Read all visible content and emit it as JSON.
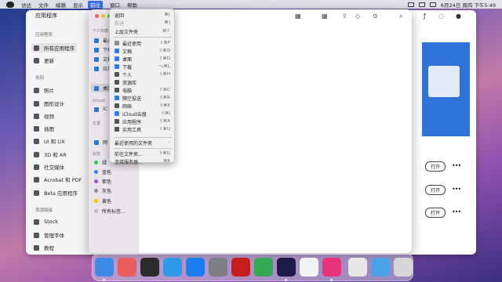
{
  "menubar": {
    "items": [
      "访达",
      "文件",
      "编辑",
      "显示",
      "前往",
      "窗口",
      "帮助"
    ],
    "active_index": 4,
    "clock": "6月24日 周四 下午5:49"
  },
  "cc": {
    "tab": "应用程序",
    "section_apps": "应用程序",
    "all_apps": "所有应用程序",
    "updates": "更新",
    "section_category": "类别",
    "categories": [
      "照片",
      "图形设计",
      "视频",
      "插图",
      "UI 和 UX",
      "3D 和 AR",
      "社交媒体",
      "Acrobat 和 PDF",
      "Beta 应用程序"
    ],
    "section_resources": "资源链接",
    "resources": [
      "Stock",
      "管理字体",
      "教程"
    ],
    "open_label": "打开",
    "more_label": "•••"
  },
  "finder": {
    "fav_header": "个人收藏",
    "fav_items": [
      "最近",
      "下载",
      "文稿",
      "应用",
      "桌面"
    ],
    "icloud_header": "iCloud",
    "icloud_items": [
      "iC"
    ],
    "loc_header": "位置",
    "loc_items": [
      "网"
    ],
    "tags_header": "标签",
    "tags": [
      {
        "label": "绿",
        "color": "#34c759"
      },
      {
        "label": "蓝色",
        "color": "#2f7cf6"
      },
      {
        "label": "紫色",
        "color": "#a050d8"
      },
      {
        "label": "灰色",
        "color": "#8e8e93"
      },
      {
        "label": "黄色",
        "color": "#f5c400"
      },
      {
        "label": "所有标签…",
        "color": "#bdbdbd"
      }
    ]
  },
  "go_menu": {
    "back": {
      "label": "返回",
      "shortcut": "⌘["
    },
    "forward": {
      "label": "前进",
      "shortcut": "⌘]"
    },
    "enclosing": {
      "label": "上层文件夹",
      "shortcut": "⌘↑"
    },
    "places": [
      {
        "label": "最近使用",
        "shortcut": "⇧⌘F",
        "color": "#8e8e93"
      },
      {
        "label": "文稿",
        "shortcut": "⇧⌘O",
        "color": "#2f7cf6"
      },
      {
        "label": "桌面",
        "shortcut": "⇧⌘D",
        "color": "#2f7cf6"
      },
      {
        "label": "下载",
        "shortcut": "⌥⌘L",
        "color": "#2f7cf6"
      },
      {
        "label": "个人",
        "shortcut": "⇧⌘H",
        "color": "#555555"
      },
      {
        "label": "资源库",
        "shortcut": "",
        "color": "#555555"
      },
      {
        "label": "电脑",
        "shortcut": "⇧⌘C",
        "color": "#555555"
      },
      {
        "label": "隔空投送",
        "shortcut": "⇧⌘R",
        "color": "#2f7cf6"
      },
      {
        "label": "网络",
        "shortcut": "⇧⌘K",
        "color": "#555555"
      },
      {
        "label": "iCloud云盘",
        "shortcut": "⇧⌘I",
        "color": "#2f7cf6"
      },
      {
        "label": "应用程序",
        "shortcut": "⇧⌘A",
        "color": "#555555"
      },
      {
        "label": "实用工具",
        "shortcut": "⇧⌘U",
        "color": "#555555"
      }
    ],
    "recent_folders": {
      "label": "最近使用的文件夹",
      "arrow": "›"
    },
    "goto_folder": {
      "label": "前往文件夹...",
      "shortcut": "⇧⌘G"
    },
    "connect_server": {
      "label": "连接服务器...",
      "shortcut": "⌘K"
    }
  },
  "dock": {
    "apps": [
      {
        "name": "finder-app",
        "color": "#3b8bea",
        "running": true
      },
      {
        "name": "launchpad-app",
        "color": "#e95d5d",
        "running": false
      },
      {
        "name": "activity-monitor-app",
        "color": "#2b2b2b",
        "running": false
      },
      {
        "name": "safari-app",
        "color": "#2f9ae8",
        "running": false
      },
      {
        "name": "app-store-app",
        "color": "#1b7cf0",
        "running": false
      },
      {
        "name": "system-preferences-app",
        "color": "#7d7d84",
        "running": false
      },
      {
        "name": "acrobat-app",
        "color": "#c81d1d",
        "running": false
      },
      {
        "name": "telegram-app",
        "color": "#35a853",
        "running": false
      },
      {
        "name": "after-effects-app",
        "color": "#1e1a4a",
        "running": true
      },
      {
        "name": "textedit-app",
        "color": "#f3f3f3",
        "running": false
      },
      {
        "name": "creative-cloud-app",
        "color": "#e8337a",
        "running": true
      },
      {
        "name": "document-file",
        "color": "#e7e7e7",
        "running": false
      },
      {
        "name": "folder-stack",
        "color": "#4aa3e6",
        "running": false
      },
      {
        "name": "trash-app",
        "color": "#d6d6d6",
        "running": false
      }
    ]
  }
}
